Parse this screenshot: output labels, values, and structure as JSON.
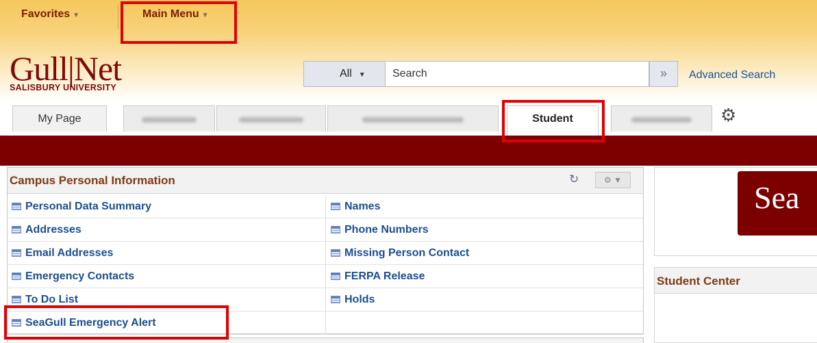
{
  "topbar": {
    "favorites": "Favorites",
    "main_menu": "Main Menu"
  },
  "logo": {
    "brand": "Gull|Net",
    "subtitle": "SALISBURY UNIVERSITY"
  },
  "search": {
    "scope": "All",
    "placeholder": "Search",
    "go_icon": "»",
    "advanced": "Advanced Search"
  },
  "tabs": {
    "my_page": "My Page",
    "student": "Student"
  },
  "pagelet": {
    "title": "Campus Personal Information",
    "left_links": [
      "Personal Data Summary",
      "Addresses",
      "Email Addresses",
      "Emergency Contacts",
      "To Do List",
      "SeaGull Emergency Alert"
    ],
    "right_links": [
      "Names",
      "Phone Numbers",
      "Missing Person Contact",
      "FERPA Release",
      "Holds"
    ]
  },
  "right": {
    "banner_text": "Sea",
    "student_center": "Student Center"
  },
  "colors": {
    "topbar": "#f6c85c",
    "maroon": "#7d0000",
    "link": "#1c4e90",
    "annotation": "#e00000"
  },
  "icons": [
    "chevron-down-icon",
    "forward-arrow-icon",
    "gear-icon",
    "refresh-icon",
    "options-icon",
    "page-link-icon"
  ]
}
